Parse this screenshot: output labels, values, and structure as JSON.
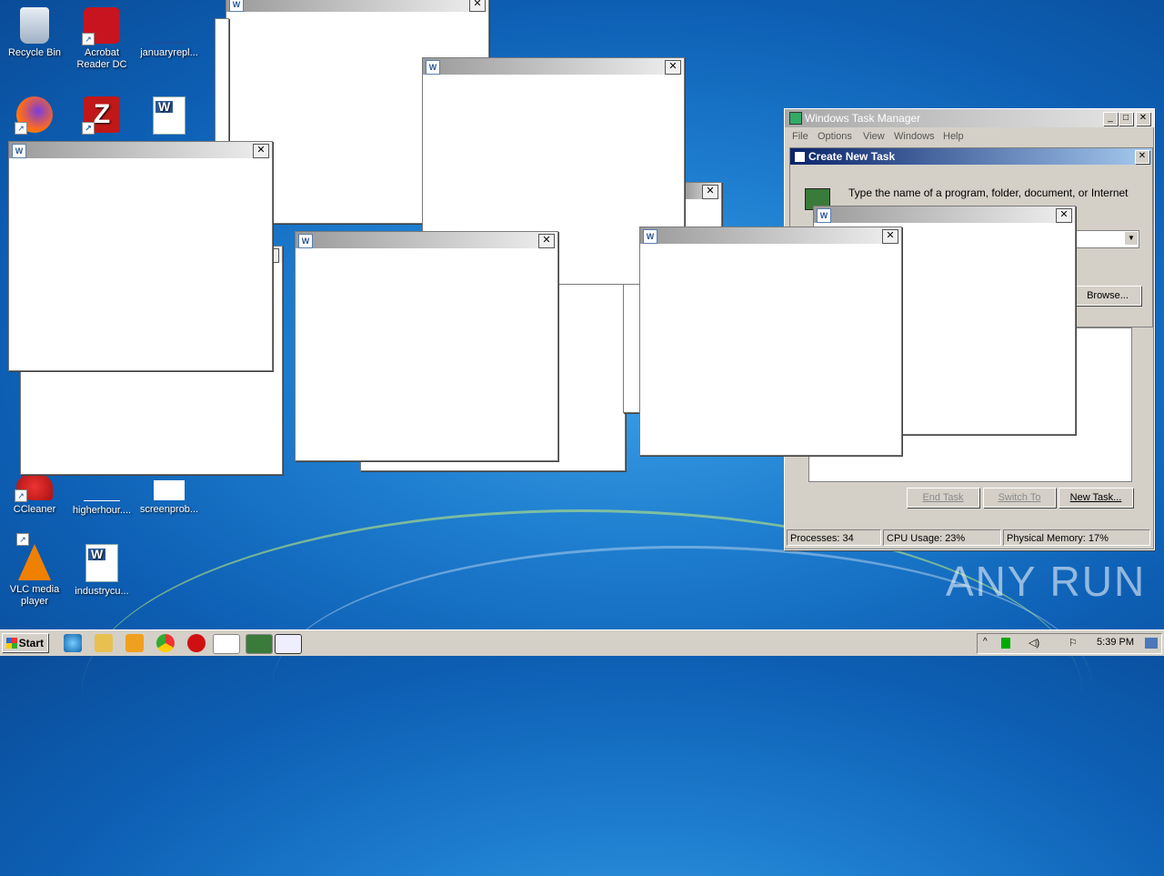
{
  "desktop": {
    "icons": [
      {
        "label": "Recycle Bin",
        "icon": "recycle-bin-icon"
      },
      {
        "label": "Acrobat Reader DC",
        "icon": "acrobat-icon"
      },
      {
        "label": "januaryrepl...",
        "icon": "word-doc-icon"
      },
      {
        "label": "",
        "icon": "firefox-icon"
      },
      {
        "label": "",
        "icon": "filezilla-icon"
      },
      {
        "label": "",
        "icon": "word-doc-icon"
      },
      {
        "label": "CCleaner",
        "icon": "ccleaner-icon"
      },
      {
        "label": "higherhour....",
        "icon": "word-doc-icon"
      },
      {
        "label": "screenprob...",
        "icon": "word-doc-icon"
      },
      {
        "label": "VLC media player",
        "icon": "vlc-icon"
      },
      {
        "label": "industrycu...",
        "icon": "word-doc-icon"
      }
    ],
    "watermark": "ANY RUN"
  },
  "task_manager": {
    "title": "Windows Task Manager",
    "menu": [
      "File",
      "Options",
      "View",
      "Windows",
      "Help"
    ],
    "buttons": {
      "end_task": "End Task",
      "switch_to": "Switch To",
      "new_task": "New Task..."
    },
    "status": {
      "processes": "Processes: 34",
      "cpu": "CPU Usage: 23%",
      "memory": "Physical Memory: 17%"
    }
  },
  "create_task_dialog": {
    "title": "Create New Task",
    "text": "Type the name of a program, folder, document, or Internet",
    "browse": "Browse..."
  },
  "taskbar": {
    "start": "Start",
    "time": "5:39 PM"
  },
  "colors": {
    "title_active": "#0a246a",
    "desktop": "#1f7fd0",
    "face": "#d4d0c8"
  }
}
